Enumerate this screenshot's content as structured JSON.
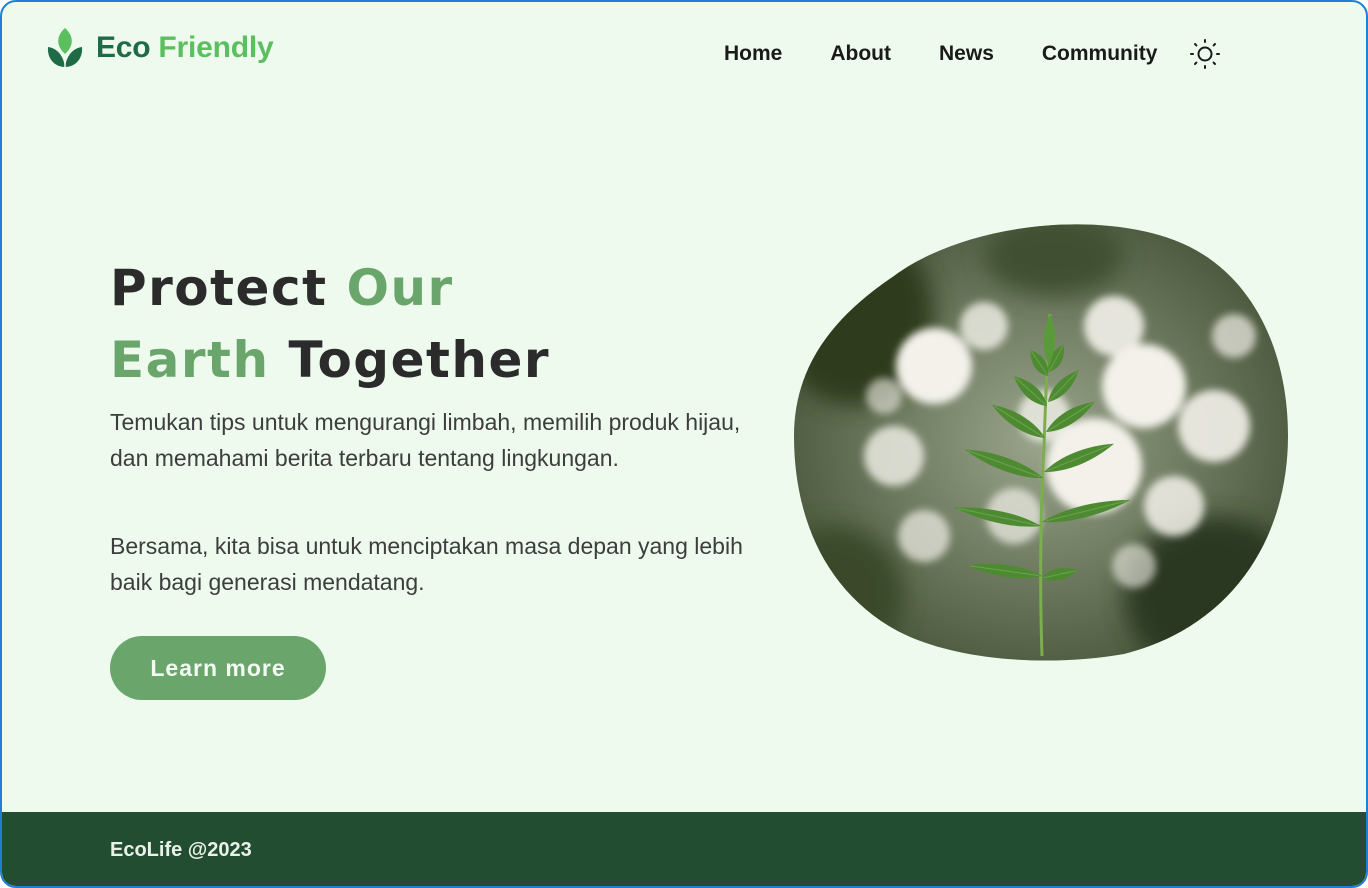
{
  "brand": {
    "logo_icon": "leaf-icon",
    "name_part1": "Eco",
    "name_part2": "Friendly",
    "colors": {
      "eco": "#1e6b45",
      "friendly": "#5cbf5f"
    }
  },
  "nav": {
    "items": [
      {
        "label": "Home"
      },
      {
        "label": "About"
      },
      {
        "label": "News"
      },
      {
        "label": "Community"
      }
    ],
    "theme_toggle_icon": "sun-icon"
  },
  "hero": {
    "title_word1": "Protect",
    "title_word2": "Our",
    "title_word3": "Earth",
    "title_word4": "Together",
    "paragraph1": "Temukan tips untuk mengurangi limbah, memilih produk hijau, dan memahami berita terbaru tentang lingkungan.",
    "paragraph2": "Bersama, kita bisa untuk menciptakan masa depan yang lebih baik bagi generasi mendatang.",
    "cta_label": "Learn more",
    "image_icon": "fern-leaf-image"
  },
  "footer": {
    "text": "EcoLife @2023"
  },
  "colors": {
    "background": "#eefaee",
    "accent": "#6aa66c",
    "footer": "#234d30",
    "text_dark": "#2b2b2b"
  }
}
